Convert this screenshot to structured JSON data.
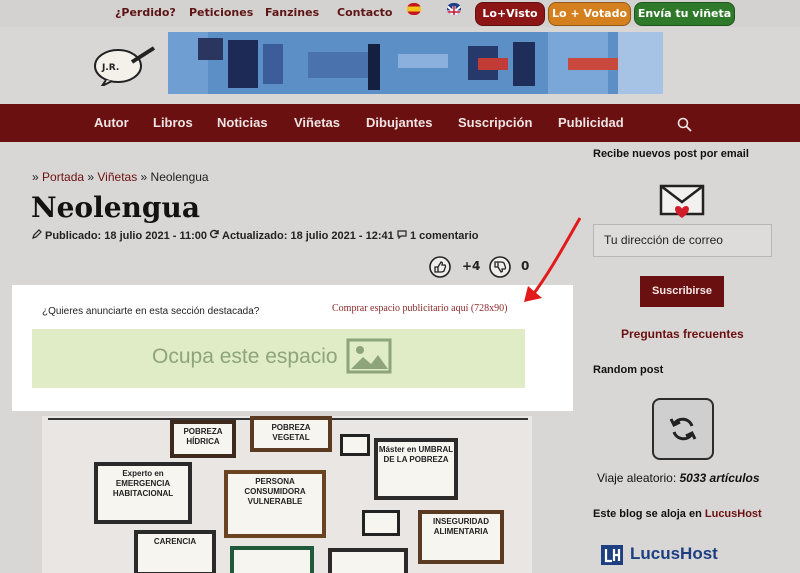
{
  "topbar": {
    "links": [
      "¿Perdido?",
      "Peticiones",
      "Fanzines",
      "Contacto"
    ],
    "pills": [
      {
        "label": "Lo+Visto",
        "color": "#8c1616"
      },
      {
        "label": "Lo + Votado",
        "color": "#d4801e"
      },
      {
        "label": "Envía tu viñeta",
        "color": "#2e7a2a"
      }
    ]
  },
  "nav": {
    "items": [
      "Autor",
      "Libros",
      "Noticias",
      "Viñetas",
      "Dibujantes",
      "Suscripción",
      "Publicidad"
    ]
  },
  "breadcrumb": {
    "sep1": "» ",
    "home": "Portada",
    "sep2": " » ",
    "section": "Viñetas",
    "sep3": " » ",
    "current": "Neolengua"
  },
  "post": {
    "title": "Neolengua",
    "published": "Publicado: 18 julio 2021 - 11:00",
    "updated": "Actualizado: 18 julio 2021 - 12:41",
    "comments": "1 comentario",
    "likes": "+4",
    "dislikes": "0"
  },
  "ad": {
    "question": "¿Quieres anunciarte en esta sección destacada?",
    "buy_link": "Comprar espacio publicitario aquí (728x90)",
    "placeholder": "Ocupa este espacio"
  },
  "illustration": {
    "frames": [
      "POBREZA HÍDRICA",
      "POBREZA VEGETAL",
      "Máster en UMBRAL DE LA POBREZA",
      "Experto en EMERGENCIA HABITACIONAL",
      "PERSONA CONSUMIDORA VULNERABLE",
      "INSEGURIDAD ALIMENTARIA",
      "CARENCIA"
    ]
  },
  "sidebar": {
    "email_heading": "Recibe nuevos post por email",
    "email_placeholder": "Tu dirección de correo",
    "subscribe": "Suscribirse",
    "faq": "Preguntas frecuentes",
    "random_heading": "Random post",
    "viaje_prefix": "Viaje aleatorio: ",
    "viaje_count": "5033 artículos",
    "host_prefix": "Este blog se aloja en ",
    "host_name": "LucusHost",
    "host_logo": "LucusHost"
  },
  "colors": {
    "brand": "#6b1010",
    "ad_slot": "#dfecc6",
    "arrow": "#e11b1b"
  }
}
